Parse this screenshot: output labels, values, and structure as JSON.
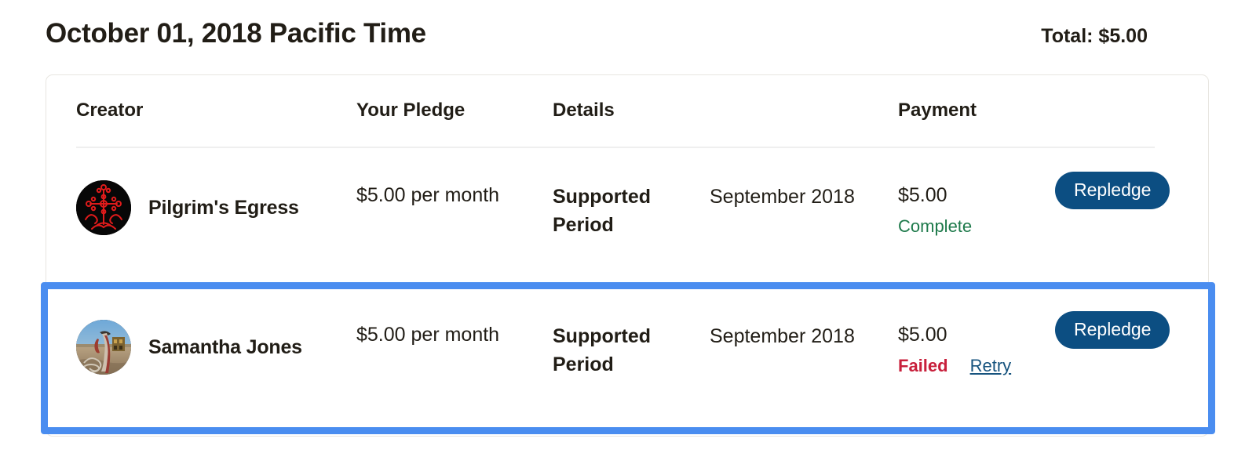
{
  "header": {
    "title": "October 01, 2018 Pacific Time",
    "total": "Total: $5.00"
  },
  "table": {
    "columns": {
      "creator": "Creator",
      "pledge": "Your Pledge",
      "details": "Details",
      "payment": "Payment"
    },
    "rows": [
      {
        "creator_name": "Pilgrim's Egress",
        "avatar": "ornate-red-cross-avatar",
        "pledge": "$5.00 per month",
        "detail_label": "Supported Period",
        "detail_value": "September 2018",
        "payment_amount": "$5.00",
        "payment_status": "Complete",
        "payment_status_type": "complete",
        "action_label": "Repledge",
        "selected": false
      },
      {
        "creator_name": "Samantha Jones",
        "avatar": "surreal-desert-painting-avatar",
        "pledge": "$5.00 per month",
        "detail_label": "Supported Period",
        "detail_value": "September 2018",
        "payment_amount": "$5.00",
        "payment_status": "Failed",
        "payment_status_type": "failed",
        "retry_label": "Retry",
        "action_label": "Repledge",
        "selected": true
      }
    ]
  },
  "colors": {
    "selection_outline": "#4a8df0",
    "button_navy": "#0c4e82",
    "status_complete_green": "#1e7a4b",
    "status_failed_red": "#c8203c",
    "link_blue": "#16537e",
    "text_primary": "#211d16",
    "card_border": "#e8e6e1"
  }
}
